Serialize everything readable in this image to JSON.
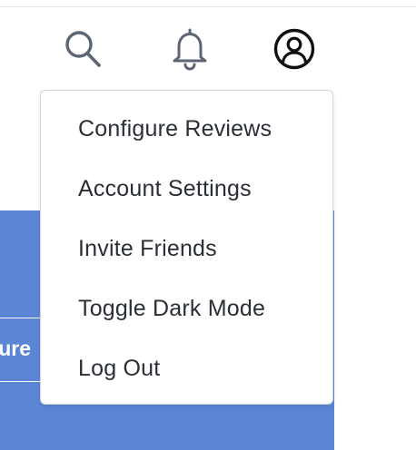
{
  "header": {
    "icons": {
      "search": "search-icon",
      "notifications": "bell-icon",
      "profile": "user-circle-icon"
    }
  },
  "background": {
    "panel_button_label": "ure",
    "accent_color": "#5b86d6"
  },
  "menu": {
    "items": [
      {
        "label": "Configure Reviews"
      },
      {
        "label": "Account Settings"
      },
      {
        "label": "Invite Friends"
      },
      {
        "label": "Toggle Dark Mode"
      },
      {
        "label": "Log Out"
      }
    ]
  }
}
